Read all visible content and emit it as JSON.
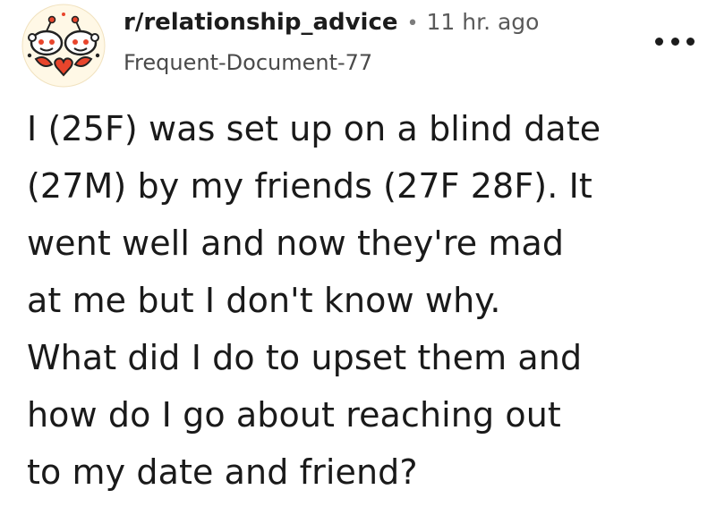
{
  "post": {
    "subreddit": "r/relationship_advice",
    "separator": "•",
    "time_ago": "11 hr. ago",
    "author": "Frequent-Document-77",
    "more_icon": "more-horizontal-icon",
    "title_lines": [
      "I (25F) was set up on a blind date",
      "(27M) by my friends (27F 28F). It",
      "went well and now they're mad",
      "at me but I don't know why.",
      "What did I do to upset them and",
      "how do I go about reaching out",
      "to my date and friend?"
    ]
  },
  "colors": {
    "avatar_red": "#e8452c",
    "avatar_light": "#fbe3b6",
    "text": "#1c1c1c",
    "muted": "#5a5a5a"
  }
}
